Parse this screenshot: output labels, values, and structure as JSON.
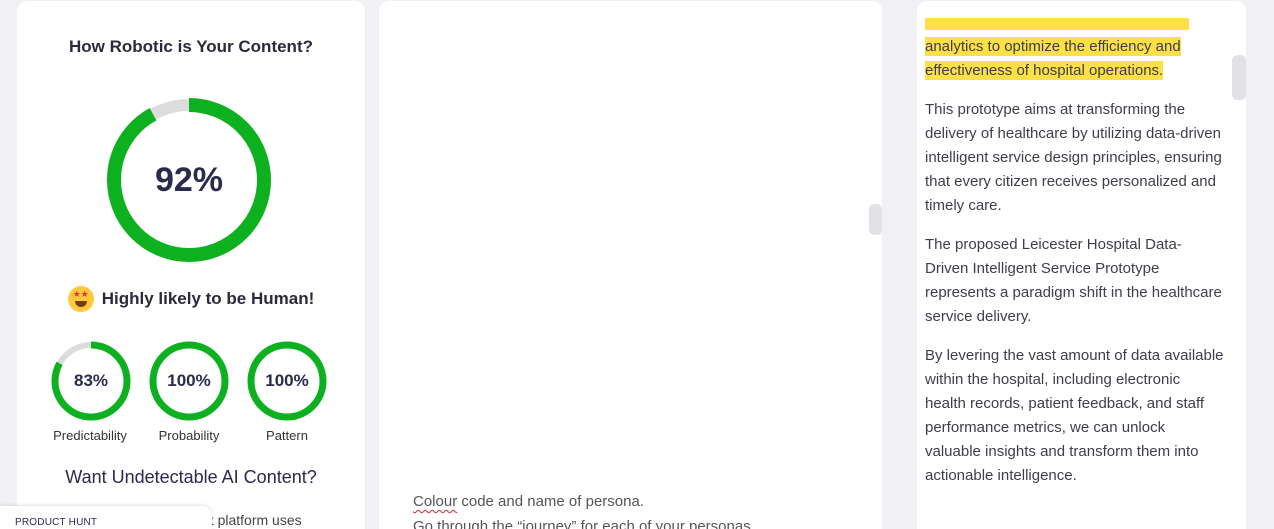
{
  "score_card": {
    "title": "How Robotic is Your Content?",
    "main_score": "92%",
    "main_score_value": 92,
    "verdict": "Highly likely to be Human!",
    "verdict_emoji": "star-struck-emoji",
    "metrics": [
      {
        "value": "83%",
        "fraction": 0.83,
        "label": "Predictability"
      },
      {
        "value": "100%",
        "fraction": 1.0,
        "label": "Probability"
      },
      {
        "value": "100%",
        "fraction": 1.0,
        "label": "Pattern"
      }
    ],
    "cta_heading": "Want Undetectable AI Content?",
    "cta_partial_text": "nt platform uses"
  },
  "product_hunt": {
    "label": "PRODUCT HUNT"
  },
  "editor": {
    "line1_misspelled": "Colour",
    "line1_rest": " code and name of persona.",
    "line2": "Go through the “journey” for each of your personas"
  },
  "result": {
    "highlight_line1": "analytics to optimize the efficiency and",
    "highlight_line2": "effectiveness of hospital operations.",
    "paragraphs": [
      "This prototype aims at transforming the delivery of healthcare by utilizing data-driven intelligent service design principles, ensuring that every citizen receives personalized and timely care.",
      "The proposed Leicester Hospital Data-Driven Intelligent Service Prototype represents a paradigm shift in the healthcare service delivery.",
      "By levering the vast amount of data available within the hospital, including electronic health records, patient feedback, and staff performance metrics, we can unlock valuable insights and transform them into actionable intelligence."
    ]
  },
  "colors": {
    "ring_progress": "#0db11f",
    "ring_track": "#dcdcdc",
    "highlight": "#fde047",
    "page_background": "#f1f1f5"
  }
}
